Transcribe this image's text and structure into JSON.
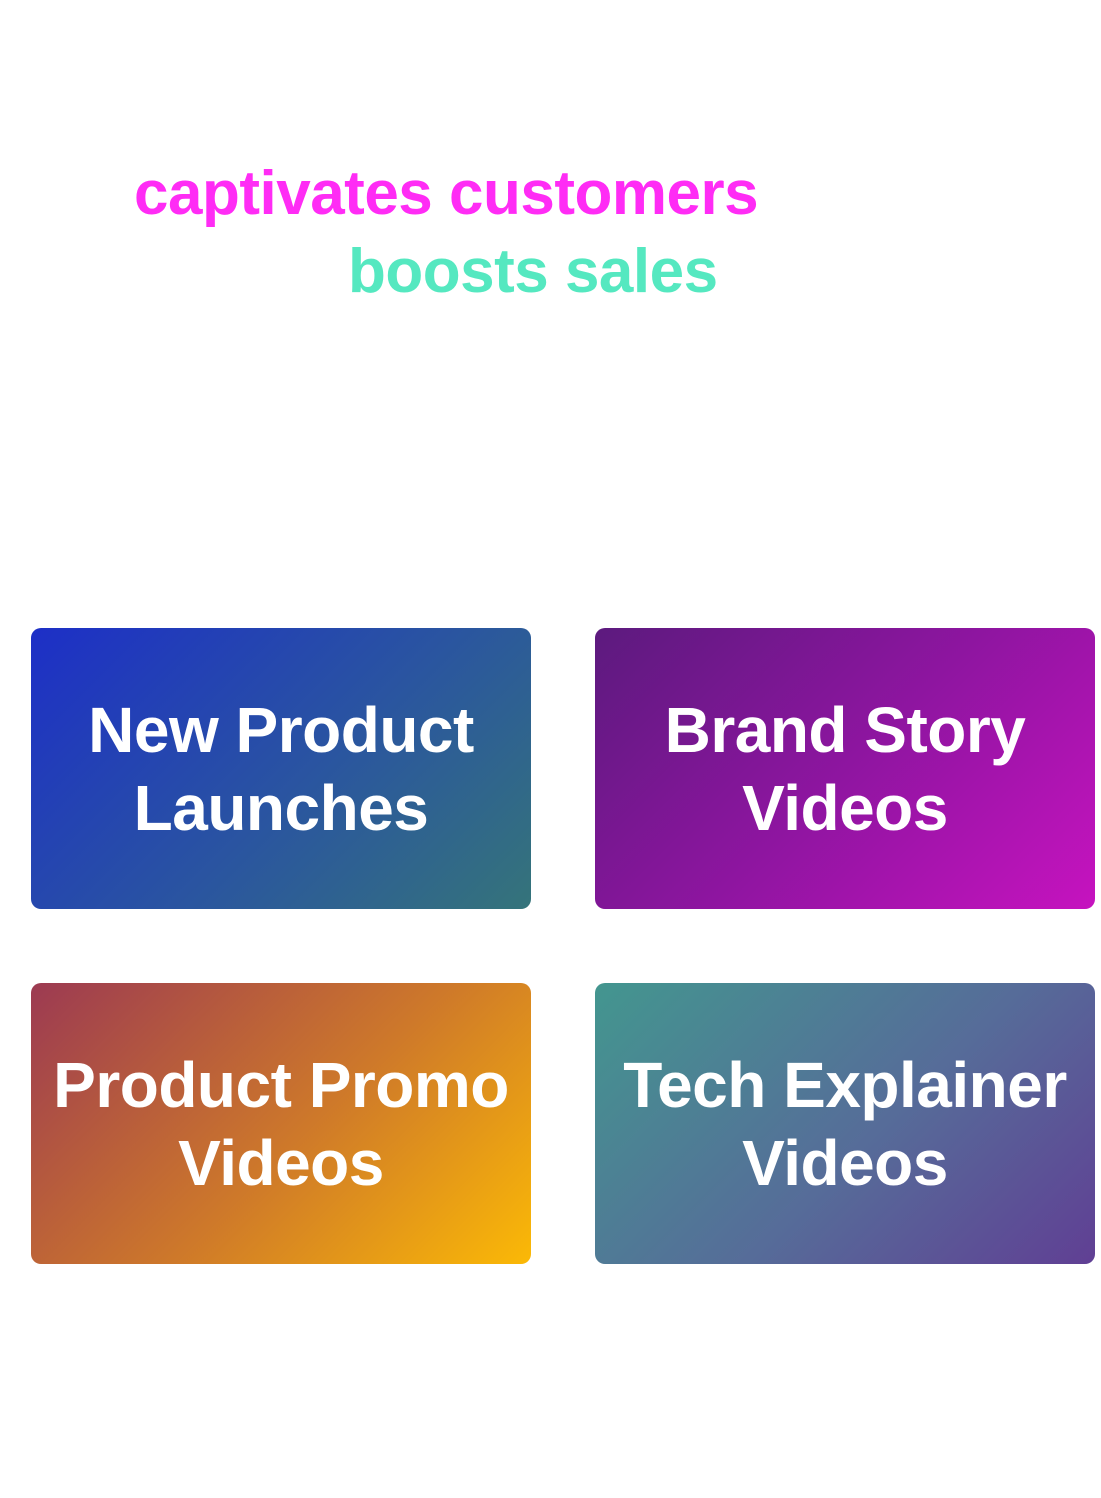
{
  "hero": {
    "line1": "captivates customers",
    "line2": "boosts sales",
    "line1_color": "#ff2cf5",
    "line2_color": "#55e8c0"
  },
  "cards": [
    {
      "line1": "New Product",
      "line2": "Launches"
    },
    {
      "line1": "Brand Story",
      "line2": "Videos"
    },
    {
      "line1": "Product Promo",
      "line2": "Videos"
    },
    {
      "line1": "Tech Explainer",
      "line2": "Videos"
    }
  ]
}
